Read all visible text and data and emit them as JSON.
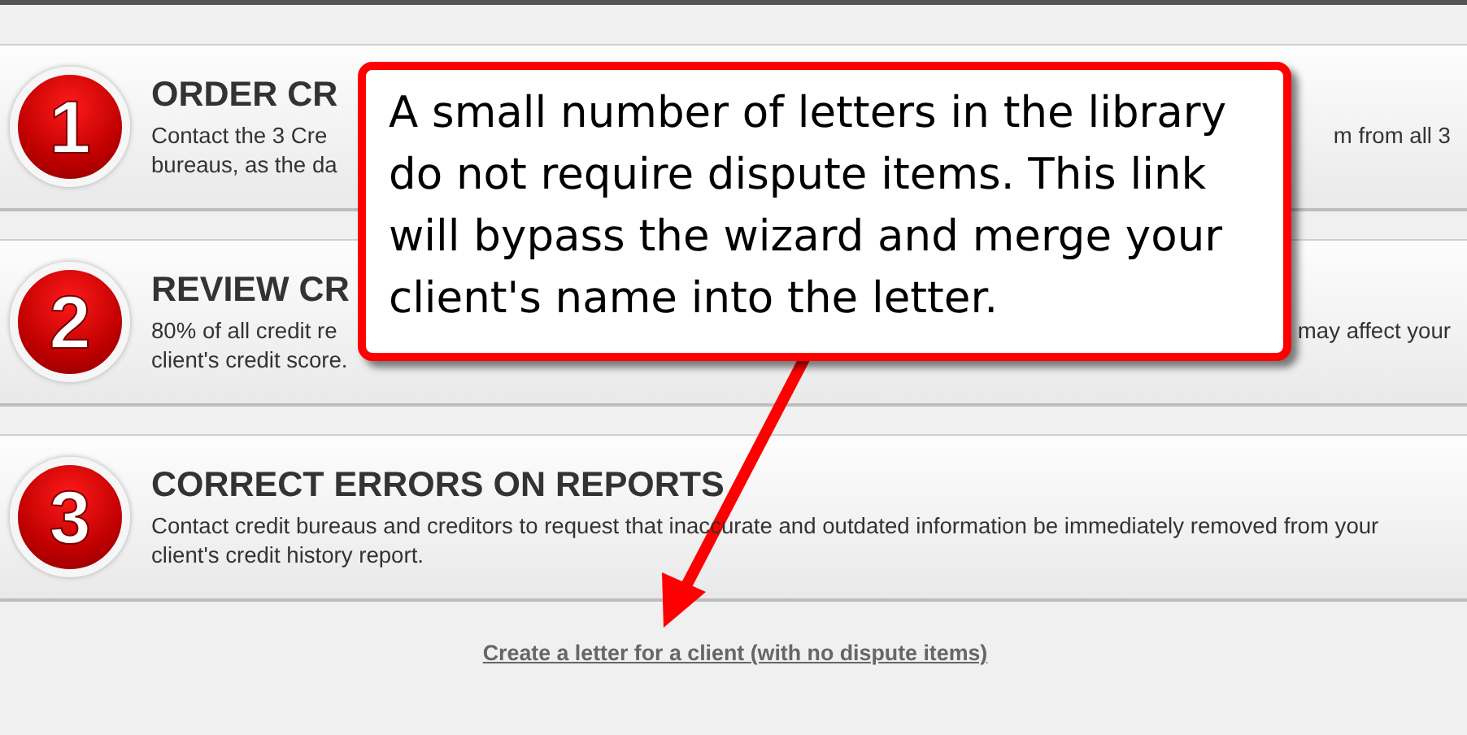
{
  "steps": [
    {
      "number": "1",
      "title": "ORDER CR",
      "lines": [
        {
          "left": "Contact the 3 Cre",
          "right": "m from all 3"
        },
        {
          "left": "bureaus, as the da"
        }
      ]
    },
    {
      "number": "2",
      "title": "REVIEW CR",
      "lines": [
        {
          "left": "80% of all credit re",
          "right": "may affect your"
        },
        {
          "left": "client's credit score."
        }
      ]
    },
    {
      "number": "3",
      "title": "CORRECT ERRORS ON REPORTS",
      "lines": [
        {
          "left": "Contact credit bureaus and creditors to request that inaccurate and outdated information be immediately removed from your"
        },
        {
          "left": "client's credit history report."
        }
      ]
    }
  ],
  "link": "Create a letter for a client (with no dispute items)",
  "callout": {
    "text": "A small number of letters in the library do not require dispute items. This link will bypass the wizard and merge your client's name into the letter."
  }
}
